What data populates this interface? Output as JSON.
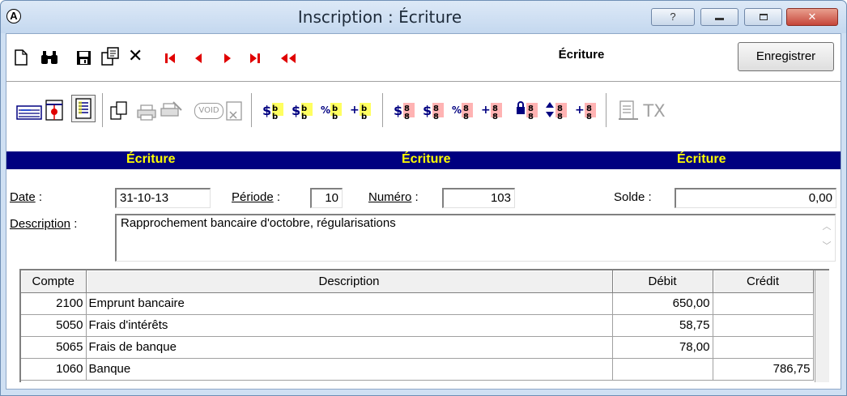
{
  "window": {
    "title": "Inscription : Écriture",
    "app_icon_letter": "A",
    "help_glyph": "?",
    "close_glyph": "✕"
  },
  "toolbar": {
    "form_title": "Écriture",
    "save_label": "Enregistrer",
    "void_label": "VOID",
    "tx_label": "TX"
  },
  "header_bar": {
    "labels": [
      "Écriture",
      "Écriture",
      "Écriture"
    ]
  },
  "form": {
    "date_label": "Date",
    "date_value": "31-10-13",
    "periode_label": "Période",
    "periode_value": "10",
    "numero_label": "Numéro",
    "numero_value": "103",
    "solde_label": "Solde :",
    "solde_value": "0,00",
    "description_label": "Description",
    "description_value": "Rapprochement bancaire d'octobre, régularisations"
  },
  "grid": {
    "columns": [
      "Compte",
      "Description",
      "Débit",
      "Crédit"
    ],
    "rows": [
      {
        "compte": "2100",
        "description": "Emprunt bancaire",
        "debit": "650,00",
        "credit": ""
      },
      {
        "compte": "5050",
        "description": "Frais d'intérêts",
        "debit": "58,75",
        "credit": ""
      },
      {
        "compte": "5065",
        "description": "Frais de banque",
        "debit": "78,00",
        "credit": ""
      },
      {
        "compte": "1060",
        "description": "Banque",
        "debit": "",
        "credit": "786,75"
      }
    ]
  },
  "colors": {
    "header_bar_bg": "#000080",
    "header_bar_text": "#ffff00",
    "nav_arrows": "#e00000",
    "close_button": "#c6463a"
  }
}
